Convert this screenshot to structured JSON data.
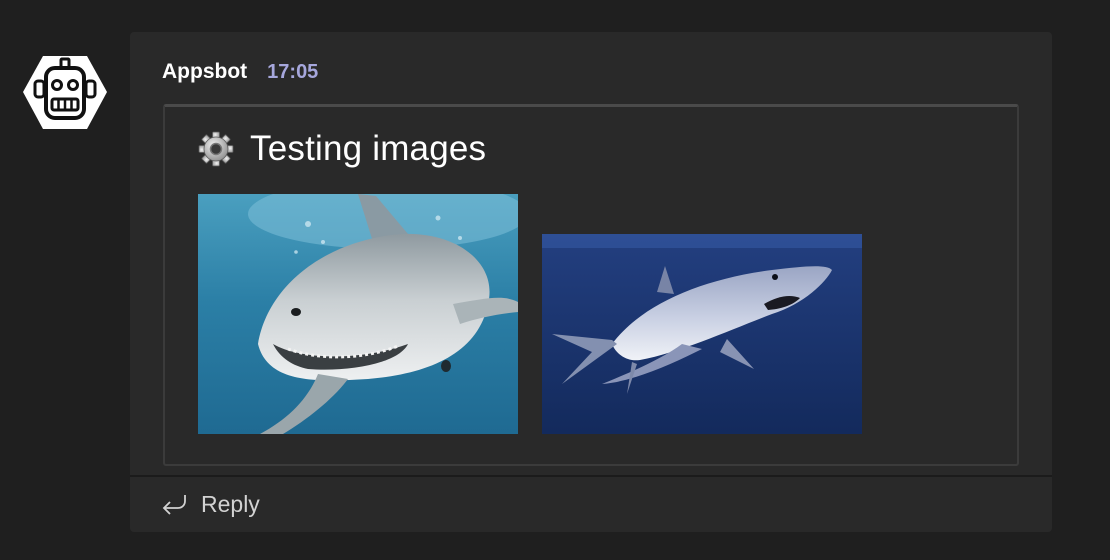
{
  "message": {
    "sender": "Appsbot",
    "timestamp": "17:05",
    "avatar_icon": "robot-icon"
  },
  "card": {
    "title": "Testing images",
    "title_icon": "gear-icon",
    "images": [
      {
        "subject": "great white shark underwater"
      },
      {
        "subject": "mako shark in deep blue water"
      }
    ]
  },
  "actions": {
    "reply_label": "Reply",
    "reply_icon": "reply-arrow-icon"
  },
  "colors": {
    "background": "#1f1f1f",
    "message_bg": "#292929",
    "timestamp": "#a6a7dc",
    "text": "#ffffff"
  }
}
